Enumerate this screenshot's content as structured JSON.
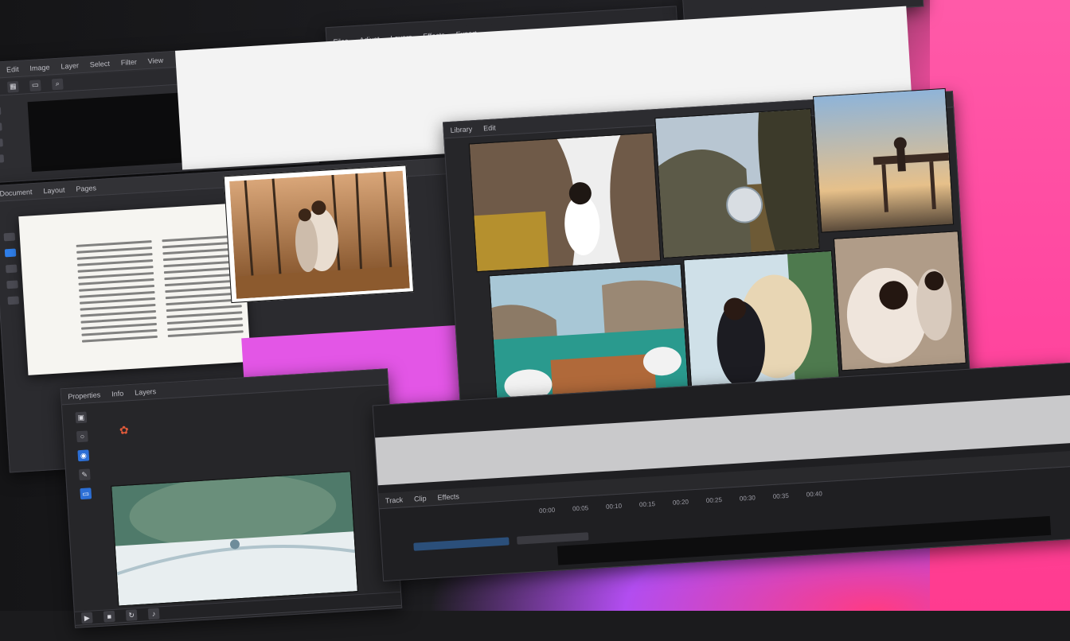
{
  "app": {
    "colors": {
      "panel": "#2d2d31",
      "accent_blue": "#2f7ee8",
      "magenta_preview": "#e356e6",
      "pink_background": "#ff4fa6"
    }
  },
  "top_window": {
    "menu": [
      "Edit",
      "Image",
      "Layer",
      "Select",
      "Filter",
      "View"
    ],
    "icons": [
      "home-icon",
      "grid-icon",
      "document-icon",
      "zoom-icon"
    ]
  },
  "toolbar_center": {
    "items": [
      "Files",
      "Adjust",
      "Layers",
      "Effects",
      "Export"
    ],
    "icons": [
      "move-icon",
      "crop-icon",
      "brush-icon",
      "image-icon"
    ]
  },
  "left_window": {
    "tabs": [
      "Document",
      "Layout",
      "Pages"
    ],
    "vertical_tools": [
      "select-tool",
      "text-tool",
      "shape-tool",
      "hand-tool",
      "zoom-tool"
    ]
  },
  "document_page": {
    "columns": 2
  },
  "gallery_panel": {
    "tabs": [
      "Library",
      "Edit"
    ]
  },
  "lower_left_panel": {
    "tabs": [
      "Properties",
      "Info",
      "Layers"
    ],
    "tools": [
      "image-icon",
      "circle-icon",
      "blur-icon",
      "pen-icon",
      "folder-icon"
    ]
  },
  "timeline": {
    "header": [
      "Track",
      "Clip",
      "Effects"
    ],
    "ruler": [
      "00:00",
      "00:05",
      "00:10",
      "00:15",
      "00:20",
      "00:25",
      "00:30",
      "00:35",
      "00:40"
    ],
    "controls": [
      "play-icon",
      "stop-icon",
      "loop-icon",
      "volume-icon"
    ]
  }
}
